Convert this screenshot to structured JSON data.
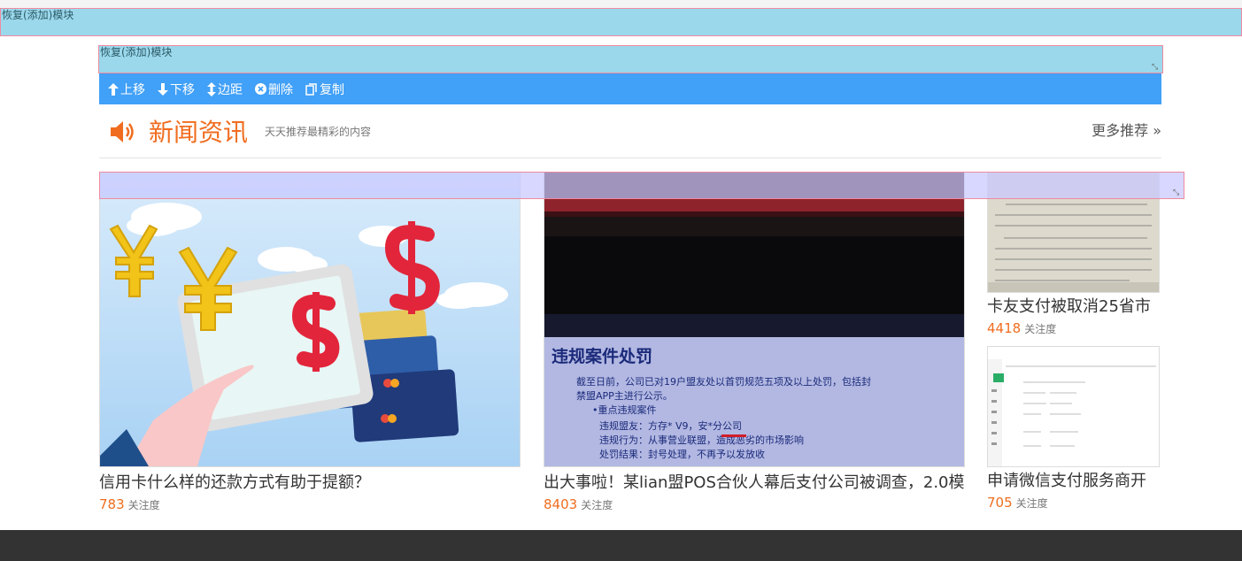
{
  "restore_module": {
    "label": "恢复(添加)模块"
  },
  "restore_module_inner": {
    "label": "恢复(添加)模块"
  },
  "toolbar": {
    "move_up": "上移",
    "move_down": "下移",
    "margin": "边距",
    "delete": "删除",
    "copy": "复制"
  },
  "section": {
    "title": "新闻资讯",
    "subtitle": "天天推荐最精彩的内容",
    "more": "更多推荐 »"
  },
  "news": [
    {
      "title": "信用卡什么样的还款方式有助于提额？",
      "count": "783",
      "count_label": "关注度"
    },
    {
      "title": "出大事啦！某lian盟POS合伙人幕后支付公司被调查，2.0模",
      "count": "8403",
      "count_label": "关注度"
    },
    {
      "title": "卡友支付被取消25省市",
      "count": "4418",
      "count_label": "关注度"
    },
    {
      "title": "申请微信支付服务商开",
      "count": "705",
      "count_label": "关注度"
    }
  ],
  "image_text": {
    "penalty_heading": "违规案件处罚",
    "penalty_lines": [
      "截至日前，公司已对19户盟友处以首罚规范五项及以上处罚，包括封",
      "禁盟APP主进行公示。",
      "•重点违规案件",
      "违规盟友：方存*  V9，安*分公司",
      "违规行为：从事营业联盟，造成恶劣的市场影响",
      "处罚结果：封号处理，不再予以发放收"
    ]
  },
  "colors": {
    "accent_orange": "#f06d1f",
    "toolbar_blue": "#41a0f7",
    "restore_bg": "#9bd8ec",
    "footer": "#333333"
  }
}
